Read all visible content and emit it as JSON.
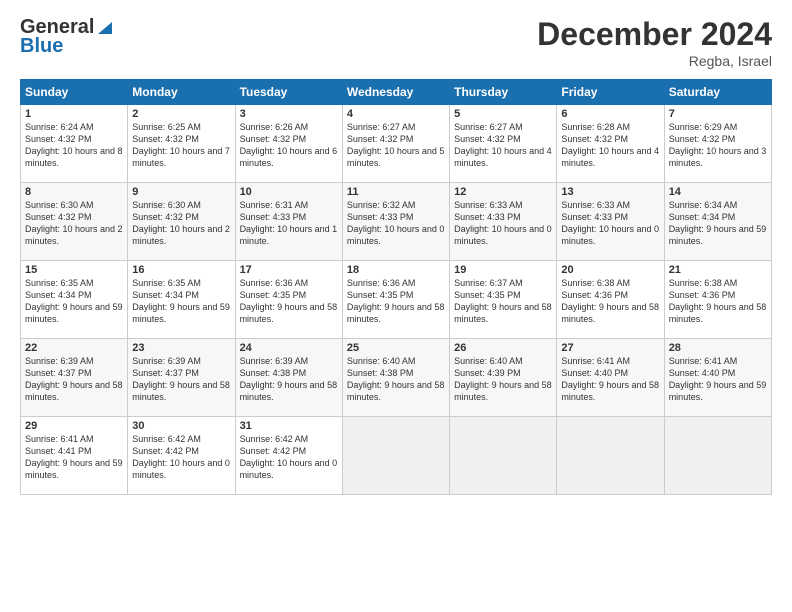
{
  "header": {
    "logo_general": "General",
    "logo_blue": "Blue",
    "title": "December 2024",
    "subtitle": "Regba, Israel"
  },
  "weekdays": [
    "Sunday",
    "Monday",
    "Tuesday",
    "Wednesday",
    "Thursday",
    "Friday",
    "Saturday"
  ],
  "rows": [
    [
      {
        "day": "1",
        "sunrise": "Sunrise: 6:24 AM",
        "sunset": "Sunset: 4:32 PM",
        "daylight": "Daylight: 10 hours and 8 minutes."
      },
      {
        "day": "2",
        "sunrise": "Sunrise: 6:25 AM",
        "sunset": "Sunset: 4:32 PM",
        "daylight": "Daylight: 10 hours and 7 minutes."
      },
      {
        "day": "3",
        "sunrise": "Sunrise: 6:26 AM",
        "sunset": "Sunset: 4:32 PM",
        "daylight": "Daylight: 10 hours and 6 minutes."
      },
      {
        "day": "4",
        "sunrise": "Sunrise: 6:27 AM",
        "sunset": "Sunset: 4:32 PM",
        "daylight": "Daylight: 10 hours and 5 minutes."
      },
      {
        "day": "5",
        "sunrise": "Sunrise: 6:27 AM",
        "sunset": "Sunset: 4:32 PM",
        "daylight": "Daylight: 10 hours and 4 minutes."
      },
      {
        "day": "6",
        "sunrise": "Sunrise: 6:28 AM",
        "sunset": "Sunset: 4:32 PM",
        "daylight": "Daylight: 10 hours and 4 minutes."
      },
      {
        "day": "7",
        "sunrise": "Sunrise: 6:29 AM",
        "sunset": "Sunset: 4:32 PM",
        "daylight": "Daylight: 10 hours and 3 minutes."
      }
    ],
    [
      {
        "day": "8",
        "sunrise": "Sunrise: 6:30 AM",
        "sunset": "Sunset: 4:32 PM",
        "daylight": "Daylight: 10 hours and 2 minutes."
      },
      {
        "day": "9",
        "sunrise": "Sunrise: 6:30 AM",
        "sunset": "Sunset: 4:32 PM",
        "daylight": "Daylight: 10 hours and 2 minutes."
      },
      {
        "day": "10",
        "sunrise": "Sunrise: 6:31 AM",
        "sunset": "Sunset: 4:33 PM",
        "daylight": "Daylight: 10 hours and 1 minute."
      },
      {
        "day": "11",
        "sunrise": "Sunrise: 6:32 AM",
        "sunset": "Sunset: 4:33 PM",
        "daylight": "Daylight: 10 hours and 0 minutes."
      },
      {
        "day": "12",
        "sunrise": "Sunrise: 6:33 AM",
        "sunset": "Sunset: 4:33 PM",
        "daylight": "Daylight: 10 hours and 0 minutes."
      },
      {
        "day": "13",
        "sunrise": "Sunrise: 6:33 AM",
        "sunset": "Sunset: 4:33 PM",
        "daylight": "Daylight: 10 hours and 0 minutes."
      },
      {
        "day": "14",
        "sunrise": "Sunrise: 6:34 AM",
        "sunset": "Sunset: 4:34 PM",
        "daylight": "Daylight: 9 hours and 59 minutes."
      }
    ],
    [
      {
        "day": "15",
        "sunrise": "Sunrise: 6:35 AM",
        "sunset": "Sunset: 4:34 PM",
        "daylight": "Daylight: 9 hours and 59 minutes."
      },
      {
        "day": "16",
        "sunrise": "Sunrise: 6:35 AM",
        "sunset": "Sunset: 4:34 PM",
        "daylight": "Daylight: 9 hours and 59 minutes."
      },
      {
        "day": "17",
        "sunrise": "Sunrise: 6:36 AM",
        "sunset": "Sunset: 4:35 PM",
        "daylight": "Daylight: 9 hours and 58 minutes."
      },
      {
        "day": "18",
        "sunrise": "Sunrise: 6:36 AM",
        "sunset": "Sunset: 4:35 PM",
        "daylight": "Daylight: 9 hours and 58 minutes."
      },
      {
        "day": "19",
        "sunrise": "Sunrise: 6:37 AM",
        "sunset": "Sunset: 4:35 PM",
        "daylight": "Daylight: 9 hours and 58 minutes."
      },
      {
        "day": "20",
        "sunrise": "Sunrise: 6:38 AM",
        "sunset": "Sunset: 4:36 PM",
        "daylight": "Daylight: 9 hours and 58 minutes."
      },
      {
        "day": "21",
        "sunrise": "Sunrise: 6:38 AM",
        "sunset": "Sunset: 4:36 PM",
        "daylight": "Daylight: 9 hours and 58 minutes."
      }
    ],
    [
      {
        "day": "22",
        "sunrise": "Sunrise: 6:39 AM",
        "sunset": "Sunset: 4:37 PM",
        "daylight": "Daylight: 9 hours and 58 minutes."
      },
      {
        "day": "23",
        "sunrise": "Sunrise: 6:39 AM",
        "sunset": "Sunset: 4:37 PM",
        "daylight": "Daylight: 9 hours and 58 minutes."
      },
      {
        "day": "24",
        "sunrise": "Sunrise: 6:39 AM",
        "sunset": "Sunset: 4:38 PM",
        "daylight": "Daylight: 9 hours and 58 minutes."
      },
      {
        "day": "25",
        "sunrise": "Sunrise: 6:40 AM",
        "sunset": "Sunset: 4:38 PM",
        "daylight": "Daylight: 9 hours and 58 minutes."
      },
      {
        "day": "26",
        "sunrise": "Sunrise: 6:40 AM",
        "sunset": "Sunset: 4:39 PM",
        "daylight": "Daylight: 9 hours and 58 minutes."
      },
      {
        "day": "27",
        "sunrise": "Sunrise: 6:41 AM",
        "sunset": "Sunset: 4:40 PM",
        "daylight": "Daylight: 9 hours and 58 minutes."
      },
      {
        "day": "28",
        "sunrise": "Sunrise: 6:41 AM",
        "sunset": "Sunset: 4:40 PM",
        "daylight": "Daylight: 9 hours and 59 minutes."
      }
    ],
    [
      {
        "day": "29",
        "sunrise": "Sunrise: 6:41 AM",
        "sunset": "Sunset: 4:41 PM",
        "daylight": "Daylight: 9 hours and 59 minutes."
      },
      {
        "day": "30",
        "sunrise": "Sunrise: 6:42 AM",
        "sunset": "Sunset: 4:42 PM",
        "daylight": "Daylight: 10 hours and 0 minutes."
      },
      {
        "day": "31",
        "sunrise": "Sunrise: 6:42 AM",
        "sunset": "Sunset: 4:42 PM",
        "daylight": "Daylight: 10 hours and 0 minutes."
      },
      null,
      null,
      null,
      null
    ]
  ]
}
